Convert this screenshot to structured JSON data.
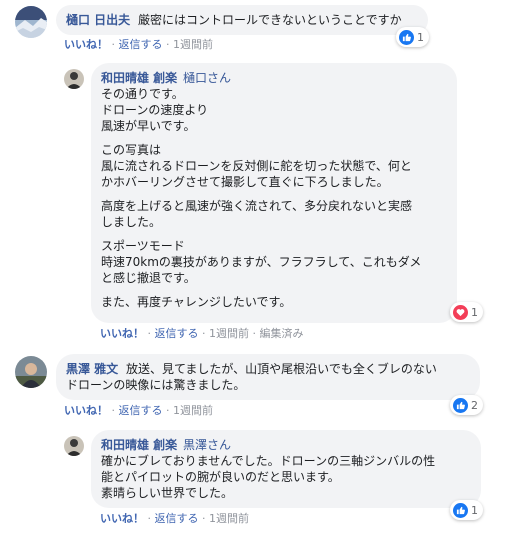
{
  "colors": {
    "link": "#385898",
    "like": "#1877f2",
    "love": "#f33e58",
    "meta": "#90949c",
    "bubble": "#f2f3f5"
  },
  "comments": [
    {
      "author": "樋口 日出夫",
      "text": "厳密にはコントロールできないということですか",
      "like_label": "いいね！",
      "reply_label": "返信する",
      "time": "1週間前",
      "reaction": {
        "icon": "like-icon",
        "count": "1"
      }
    },
    {
      "author": "和田晴雄 創楽",
      "mention": "樋口さん",
      "paragraphs": [
        [
          "その通りです。",
          "ドローンの速度より",
          "風速が早いです。"
        ],
        [
          "この写真は",
          "風に流されるドローンを反対側に舵を切った状態で、何と",
          "かホバーリングさせて撮影して直ぐに下ろしました。"
        ],
        [
          "高度を上げると風速が強く流されて、多分戻れないと実感",
          "しました。"
        ],
        [
          "スポーツモード",
          "時速70kmの裏技がありますが、フラフラして、これもダメ",
          "と感じ撤退です。"
        ],
        [
          "また、再度チャレンジしたいです。"
        ]
      ],
      "like_label": "いいね！",
      "reply_label": "返信する",
      "time": "1週間前",
      "edited": "編集済み",
      "reaction": {
        "icon": "love-icon",
        "count": "1"
      }
    },
    {
      "author": "黒澤 雅文",
      "text_lines": [
        "放送、見てましたが、山頂や尾根沿いでも全くブレのない",
        "ドローンの映像には驚きました。"
      ],
      "like_label": "いいね！",
      "reply_label": "返信する",
      "time": "1週間前",
      "reaction": {
        "icon": "like-icon",
        "count": "2"
      }
    },
    {
      "author": "和田晴雄 創楽",
      "mention": "黒澤さん",
      "lines": [
        "確かにブレておりませんでした。ドローンの三軸ジンバルの性",
        "能とパイロットの腕が良いのだと思います。",
        "素晴らしい世界でした。"
      ],
      "like_label": "いいね！",
      "reply_label": "返信する",
      "time": "1週間前",
      "reaction": {
        "icon": "like-icon",
        "count": "1"
      }
    }
  ]
}
